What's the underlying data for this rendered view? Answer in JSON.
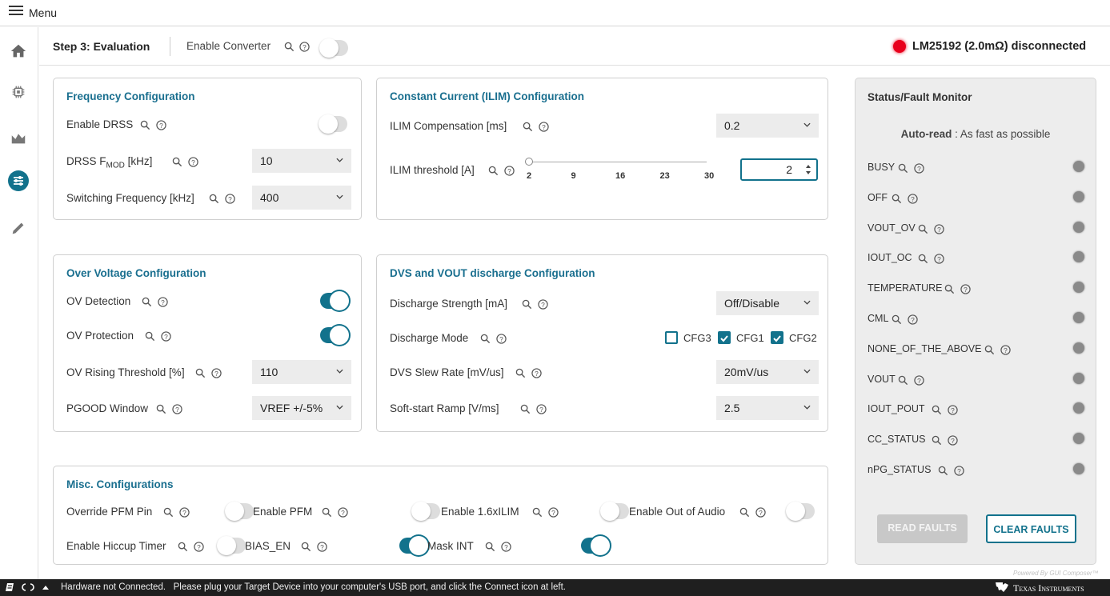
{
  "menu": {
    "label": "Menu"
  },
  "sidebar": {
    "icons": [
      "home-icon",
      "chip-icon",
      "chart-icon",
      "tune-icon",
      "pencil-icon"
    ]
  },
  "header": {
    "step": "Step 3: Evaluation",
    "enable_converter": "Enable Converter",
    "enable_converter_on": false,
    "device_status": "LM25192 (2.0mΩ) disconnected",
    "status_color": "#e8001c"
  },
  "freq": {
    "title": "Frequency Configuration",
    "enable_drss": "Enable DRSS",
    "enable_drss_on": false,
    "drss_fmod_pre": "DRSS F",
    "drss_fmod_sub": "MOD",
    "drss_fmod_post": "[kHz]",
    "drss_fmod_value": "10",
    "sw_freq": "Switching Frequency [kHz]",
    "sw_freq_value": "400"
  },
  "ilim": {
    "title": "Constant Current (ILIM) Configuration",
    "comp": "ILIM Compensation [ms]",
    "comp_value": "0.2",
    "threshold": "ILIM threshold [A]",
    "ticks": [
      "2",
      "9",
      "16",
      "23",
      "30"
    ],
    "threshold_value": "2",
    "slider_min": 2,
    "slider_max": 30
  },
  "ov": {
    "title": "Over Voltage Configuration",
    "detection": "OV Detection",
    "detection_on": true,
    "protection": "OV Protection",
    "protection_on": true,
    "rising": "OV Rising Threshold [%]",
    "rising_value": "110",
    "pgood": "PGOOD Window",
    "pgood_value": "VREF +/-5%"
  },
  "dvs": {
    "title": "DVS and VOUT discharge Configuration",
    "strength": "Discharge Strength [mA]",
    "strength_value": "Off/Disable",
    "mode": "Discharge Mode",
    "cfgs": [
      {
        "label": "CFG3",
        "checked": false
      },
      {
        "label": "CFG1",
        "checked": true
      },
      {
        "label": "CFG2",
        "checked": true
      }
    ],
    "slew": "DVS Slew Rate [mV/us]",
    "slew_value": "20mV/us",
    "softstart": "Soft-start Ramp [V/ms]",
    "softstart_value": "2.5"
  },
  "misc": {
    "title": "Misc. Configurations",
    "override_pfm": "Override PFM Pin",
    "override_pfm_on": false,
    "enable_pfm": "Enable PFM",
    "enable_pfm_on": false,
    "enable_16x": "Enable 1.6xILIM",
    "enable_16x_on": false,
    "enable_audio": "Enable Out of Audio",
    "enable_audio_on": false,
    "hiccup": "Enable Hiccup Timer",
    "hiccup_on": false,
    "bias_en": "BIAS_EN",
    "bias_en_on": true,
    "mask_int": "Mask INT",
    "mask_int_on": true
  },
  "status": {
    "title": "Status/Fault Monitor",
    "autoread_label": "Auto-read",
    "autoread_value": ": As fast as possible",
    "items": [
      "BUSY",
      "OFF",
      "VOUT_OV",
      "IOUT_OC",
      "TEMPERATURE",
      "CML",
      "NONE_OF_THE_ABOVE",
      "VOUT",
      "IOUT_POUT",
      "CC_STATUS",
      "nPG_STATUS"
    ],
    "read_faults": "READ FAULTS",
    "clear_faults": "CLEAR FAULTS",
    "powered_by": "Powered By GUI Composer™"
  },
  "statusbar": {
    "message": "Hardware not Connected.   Please plug your Target Device into your computer's USB port, and click the Connect icon at left.",
    "brand": "Texas Instruments"
  },
  "colors": {
    "accent": "#12728c",
    "title": "#1a6f8f",
    "statusbar": "#1f1f1f",
    "led_off": "#8a8a8a"
  }
}
